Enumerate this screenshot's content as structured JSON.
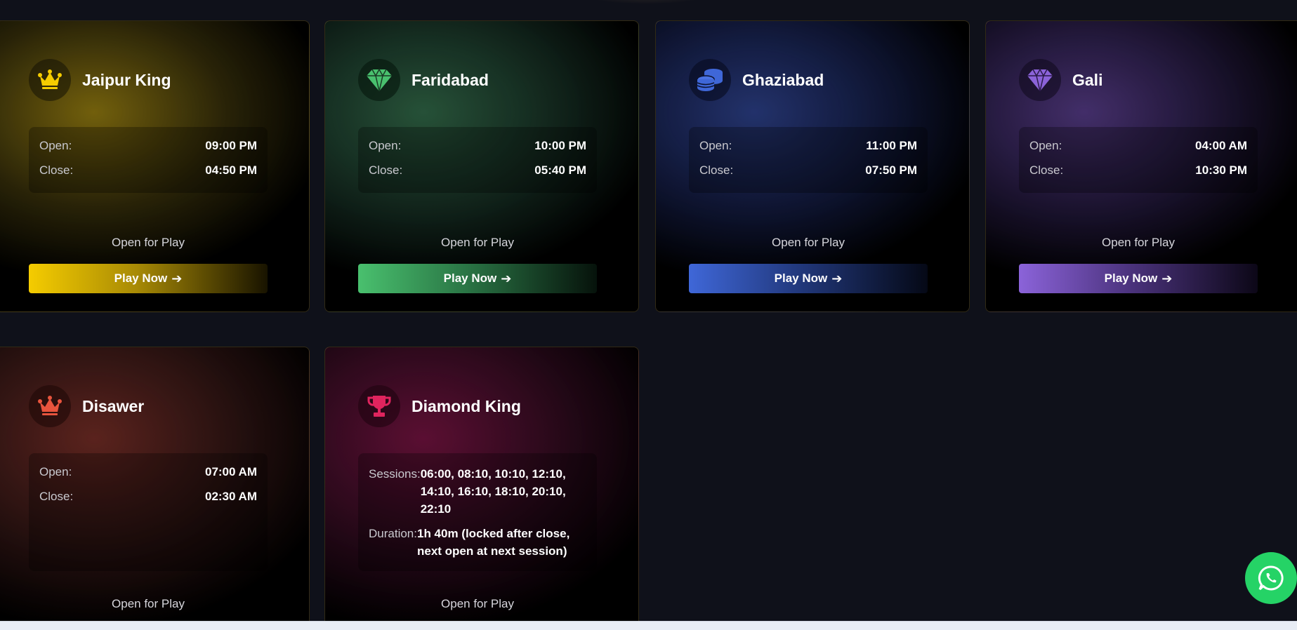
{
  "status_text": "Open for Play",
  "play_label": "Play Now",
  "open_label": "Open:",
  "close_label": "Close:",
  "cards": [
    {
      "title": "Jaipur King",
      "icon": "crown-icon",
      "accent": "#f5cc00",
      "open": "09:00 PM",
      "close": "04:50 PM"
    },
    {
      "title": "Faridabad",
      "icon": "gem-icon",
      "accent": "#49c06e",
      "open": "10:00 PM",
      "close": "05:40 PM"
    },
    {
      "title": "Ghaziabad",
      "icon": "coins-icon",
      "accent": "#3f67d8",
      "open": "11:00 PM",
      "close": "07:50 PM"
    },
    {
      "title": "Gali",
      "icon": "gem-icon",
      "accent": "#8b63d9",
      "open": "04:00 AM",
      "close": "10:30 PM"
    },
    {
      "title": "Disawer",
      "icon": "crown-icon",
      "accent": "#e8543d",
      "open": "07:00 AM",
      "close": "02:30 AM"
    },
    {
      "title": "Diamond King",
      "icon": "trophy-icon",
      "accent": "#e0245e",
      "sessions_label": "Sessions:",
      "sessions": "06:00, 08:10, 10:10, 12:10, 14:10, 16:10, 18:10, 20:10, 22:10",
      "duration_label": "Duration:",
      "duration": "1h 40m (locked after close, next open at next session)"
    }
  ]
}
